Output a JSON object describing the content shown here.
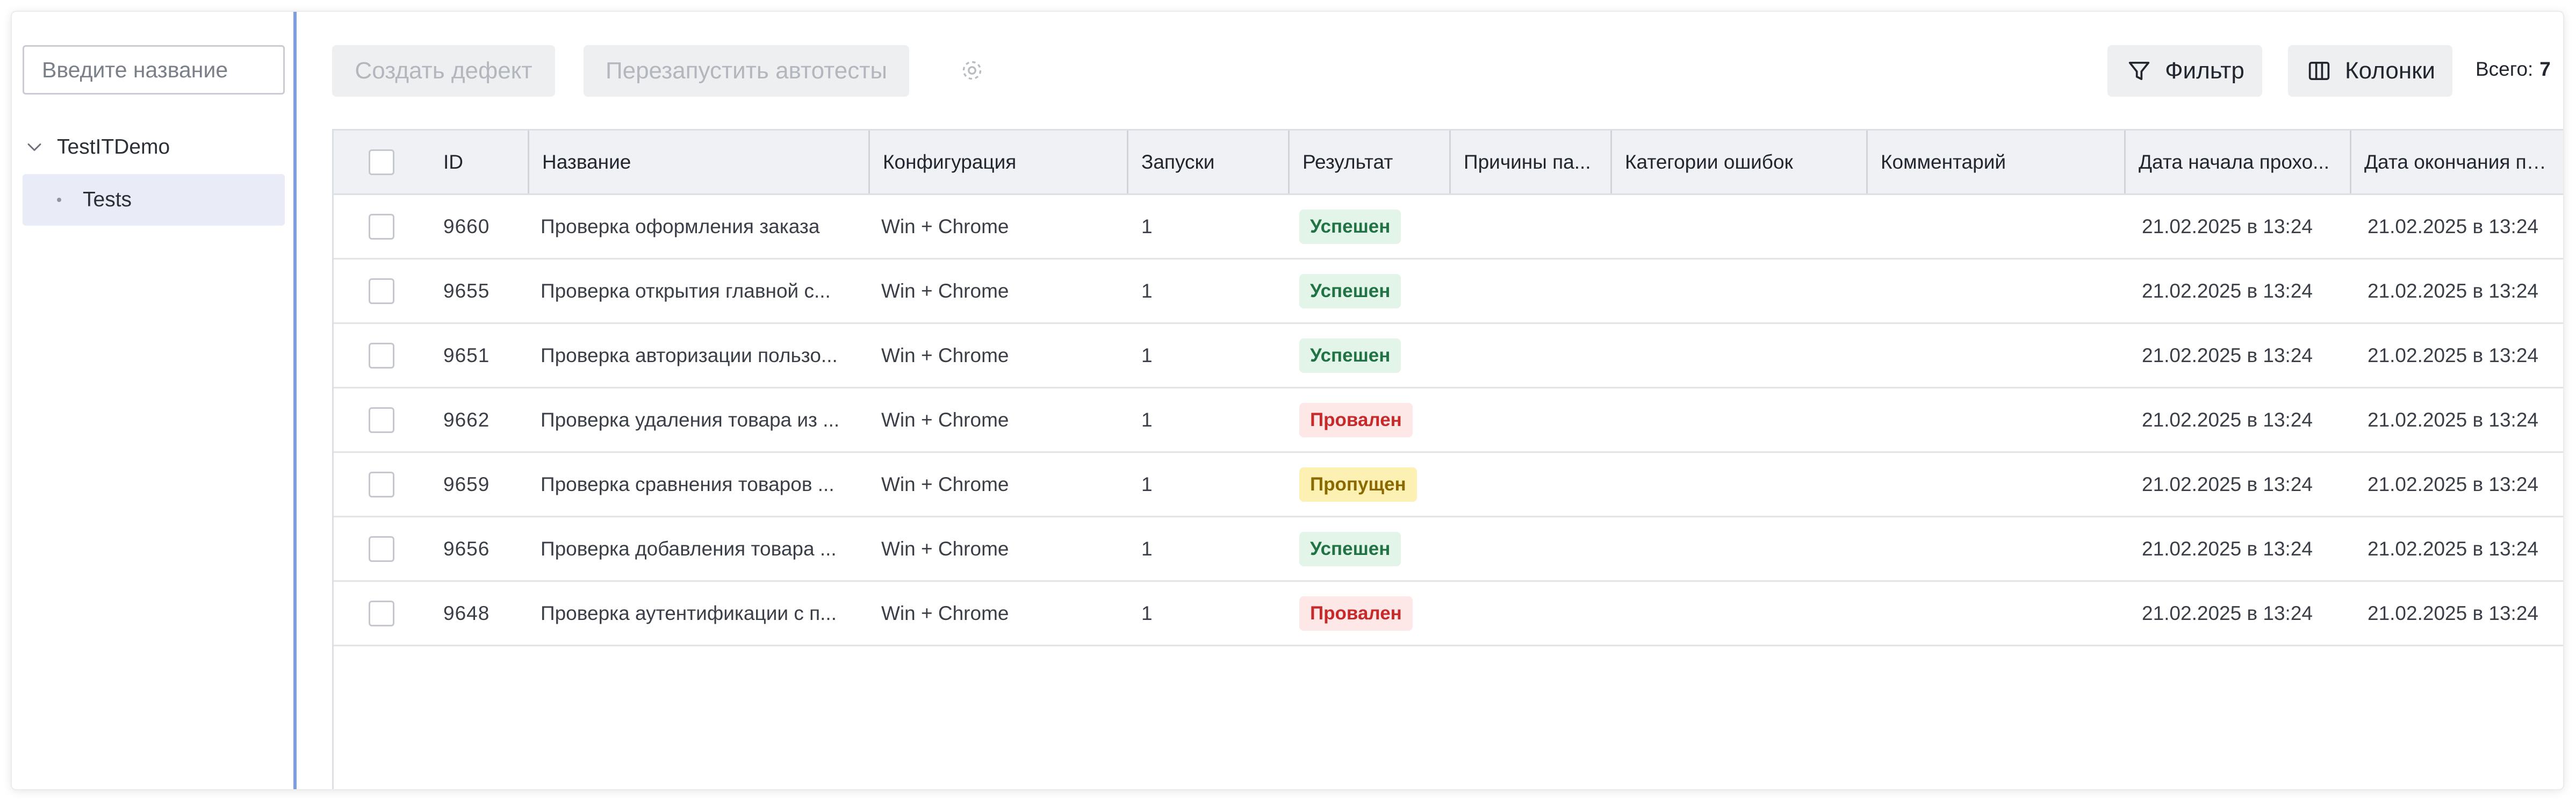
{
  "sidebar": {
    "search_placeholder": "Введите название",
    "tree_root": "TestITDemo",
    "tree_child": "Tests"
  },
  "toolbar": {
    "create_defect": "Создать дефект",
    "restart_autotests": "Перезапустить автотесты",
    "filter": "Фильтр",
    "columns": "Колонки",
    "total_label": "Всего:",
    "total_value": "7"
  },
  "table": {
    "headers": [
      "ID",
      "Название",
      "Конфигурация",
      "Запуски",
      "Результат",
      "Причины па...",
      "Категории ошибок",
      "Комментарий",
      "Дата начала прохо...",
      "Дата окончания пр..."
    ],
    "rows": [
      {
        "id": "9660",
        "name": "Проверка оформления заказа",
        "config": "Win + Chrome",
        "runs": "1",
        "result": "Успешен",
        "status": "success",
        "start": "21.02.2025 в 13:24",
        "end": "21.02.2025 в 13:24"
      },
      {
        "id": "9655",
        "name": "Проверка открытия главной с...",
        "config": "Win + Chrome",
        "runs": "1",
        "result": "Успешен",
        "status": "success",
        "start": "21.02.2025 в 13:24",
        "end": "21.02.2025 в 13:24"
      },
      {
        "id": "9651",
        "name": "Проверка авторизации пользо...",
        "config": "Win + Chrome",
        "runs": "1",
        "result": "Успешен",
        "status": "success",
        "start": "21.02.2025 в 13:24",
        "end": "21.02.2025 в 13:24"
      },
      {
        "id": "9662",
        "name": "Проверка удаления товара из ...",
        "config": "Win + Chrome",
        "runs": "1",
        "result": "Провален",
        "status": "failed",
        "start": "21.02.2025 в 13:24",
        "end": "21.02.2025 в 13:24"
      },
      {
        "id": "9659",
        "name": "Проверка сравнения товаров ...",
        "config": "Win + Chrome",
        "runs": "1",
        "result": "Пропущен",
        "status": "skipped",
        "start": "21.02.2025 в 13:24",
        "end": "21.02.2025 в 13:24"
      },
      {
        "id": "9656",
        "name": "Проверка добавления товара ...",
        "config": "Win + Chrome",
        "runs": "1",
        "result": "Успешен",
        "status": "success",
        "start": "21.02.2025 в 13:24",
        "end": "21.02.2025 в 13:24"
      },
      {
        "id": "9648",
        "name": "Проверка аутентификации с п...",
        "config": "Win + Chrome",
        "runs": "1",
        "result": "Провален",
        "status": "failed",
        "start": "21.02.2025 в 13:24",
        "end": "21.02.2025 в 13:24"
      }
    ]
  },
  "colors": {
    "accent_border": "#7f9fdc",
    "selected_tree_bg": "#e9ecf7",
    "status_success_bg": "#e3f4e8",
    "status_success_text": "#217346",
    "status_failed_bg": "#fde7e7",
    "status_failed_text": "#c62a2a",
    "status_skipped_bg": "#fdf0b3",
    "status_skipped_text": "#8a6a00"
  },
  "icons": {
    "tree_toggle": "chevron-down-icon",
    "filter": "filter-icon",
    "columns": "columns-icon",
    "settings": "gear-icon"
  }
}
